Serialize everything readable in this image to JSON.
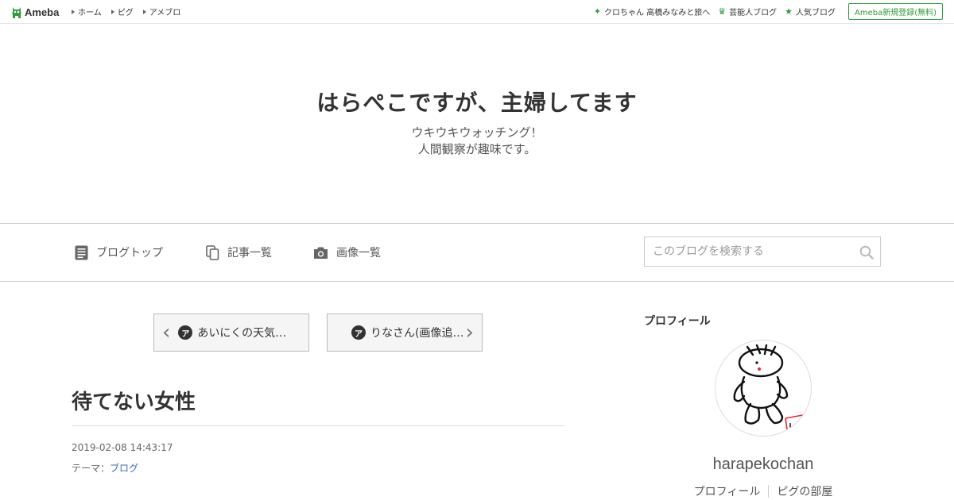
{
  "topbar": {
    "logo": "Ameba",
    "nav": [
      "ホーム",
      "ピグ",
      "アメブロ"
    ],
    "right_links": [
      {
        "icon": "sparkle-icon",
        "label": "クロちゃん 高橋みなみと旅へ"
      },
      {
        "icon": "crown-icon",
        "label": "芸能人ブログ"
      },
      {
        "icon": "star-icon",
        "label": "人気ブログ"
      }
    ],
    "signup": "Ameba新規登録(無料)"
  },
  "header": {
    "title": "はらぺこですが、主婦してます",
    "description_line1": "ウキウキウォッチング！",
    "description_line2": "人間観察が趣味です。"
  },
  "nav": {
    "blog_top": "ブログトップ",
    "articles": "記事一覧",
    "images": "画像一覧",
    "search_placeholder": "このブログを検索する"
  },
  "pager": {
    "prev": "あいにくの天気…",
    "next": "りなさん(画像追…",
    "badge": "ア"
  },
  "article": {
    "title": "待てない女性",
    "date": "2019-02-08 14:43:17",
    "theme_label": "テーマ：",
    "theme_value": "ブログ"
  },
  "profile": {
    "heading": "プロフィール",
    "name": "harapekochan",
    "links": [
      "プロフィール",
      "ピグの部屋"
    ]
  },
  "colors": {
    "accent_green": "#2f9b3a",
    "link_blue": "#3a6bb5"
  }
}
